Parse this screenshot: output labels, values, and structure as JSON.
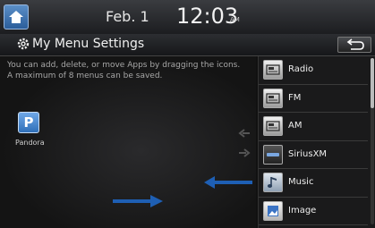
{
  "status_bar": {
    "date": "Feb.  1",
    "time": "12:03",
    "ampm": "AM"
  },
  "header": {
    "title": "My Menu Settings"
  },
  "info": {
    "line1": "You can add, delete, or move Apps by dragging the icons.",
    "line2": "A maximum of 8 menus can be saved."
  },
  "my_menu": [
    {
      "label": "Pandora",
      "icon": "pandora-icon",
      "glyph": "P"
    }
  ],
  "app_list": [
    {
      "label": "Radio",
      "icon": "radio-icon"
    },
    {
      "label": "FM",
      "icon": "fm-icon"
    },
    {
      "label": "AM",
      "icon": "am-icon"
    },
    {
      "label": "SiriusXM",
      "icon": "siriusxm-icon"
    },
    {
      "label": "Music",
      "icon": "music-icon"
    },
    {
      "label": "Image",
      "icon": "image-icon"
    }
  ],
  "colors": {
    "accent_blue": "#1e5fb4",
    "panel": "#1a1a1b"
  }
}
